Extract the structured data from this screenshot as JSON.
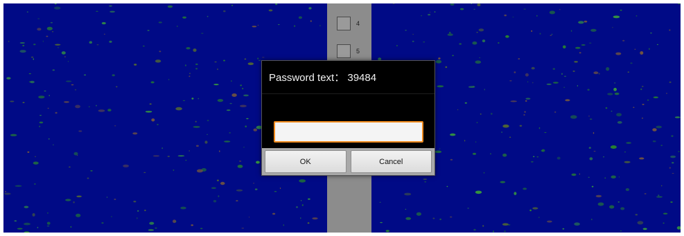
{
  "background": {
    "color": "#000a86",
    "speckle_colors": [
      "#2a8a2a",
      "#3aa03a",
      "#556b2f",
      "#7a5a3a",
      "#1f6e3a"
    ]
  },
  "strip": {
    "items": [
      {
        "label": "4"
      },
      {
        "label": "5"
      }
    ]
  },
  "dialog": {
    "title": "Password text： 39484",
    "input": {
      "value": "",
      "placeholder": ""
    },
    "buttons": {
      "ok": "OK",
      "cancel": "Cancel"
    },
    "accent_color": "#f08a1c"
  }
}
